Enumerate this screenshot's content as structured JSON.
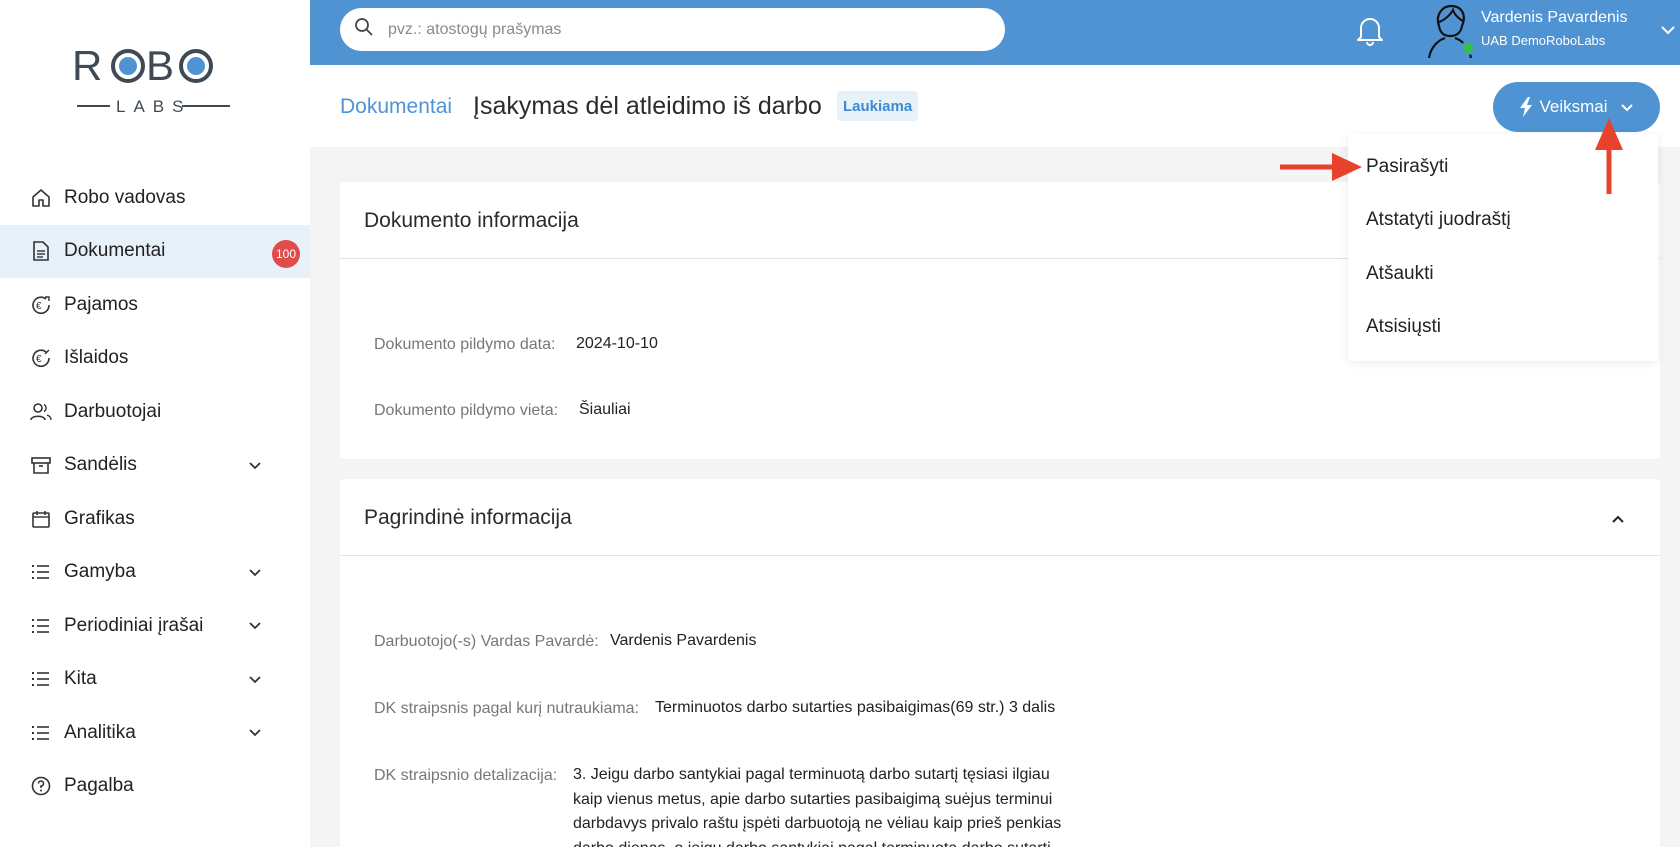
{
  "logo": {
    "text_top": "ROBO",
    "text_bottom": "LABS"
  },
  "sidebar": {
    "items": [
      {
        "label": "Robo vadovas"
      },
      {
        "label": "Dokumentai",
        "badge": "100"
      },
      {
        "label": "Pajamos"
      },
      {
        "label": "Išlaidos"
      },
      {
        "label": "Darbuotojai"
      },
      {
        "label": "Sandėlis"
      },
      {
        "label": "Grafikas"
      },
      {
        "label": "Gamyba"
      },
      {
        "label": "Periodiniai įrašai"
      },
      {
        "label": "Kita"
      },
      {
        "label": "Analitika"
      },
      {
        "label": "Pagalba"
      }
    ]
  },
  "topbar": {
    "search_placeholder": "pvz.: atostogų prašymas",
    "user_name": "Vardenis Pavardenis",
    "user_company": "UAB DemoRoboLabs"
  },
  "header": {
    "breadcrumb": "Dokumentai",
    "title": "Įsakymas dėl atleidimo iš darbo",
    "status": "Laukiama",
    "actions_label": "Veiksmai"
  },
  "dropdown": {
    "items": [
      "Pasirašyti",
      "Atstatyti juodraštį",
      "Atšaukti",
      "Atsisiųsti"
    ]
  },
  "doc_info": {
    "title": "Dokumento informacija",
    "date_label": "Dokumento pildymo data:",
    "date_value": "2024-10-10",
    "place_label": "Dokumento pildymo vieta:",
    "place_value": "Šiauliai"
  },
  "main_info": {
    "title": "Pagrindinė informacija",
    "employee_label": "Darbuotojo(-s) Vardas Pavardė:",
    "employee_value": "Vardenis Pavardenis",
    "article_label": "DK straipsnis pagal kurį nutraukiama:",
    "article_value": "Terminuotos darbo sutarties pasibaigimas(69 str.) 3 dalis",
    "detail_label": "DK straipsnio detalizacija:",
    "detail_lines": [
      "3. Jeigu darbo santykiai pagal terminuotą darbo sutartį tęsiasi ilgiau",
      "kaip vienus metus, apie darbo sutarties pasibaigimą suėjus terminui",
      "darbdavys privalo raštu įspėti darbuotoją ne vėliau kaip prieš penkias",
      "darbo dienas, o jeigu darbo santykiai pagal terminuotą darbo sutartį"
    ]
  },
  "colors": {
    "accent": "#4f93d3",
    "badge": "#e04b4b",
    "arrow": "#e8412c",
    "online": "#33c04a"
  }
}
